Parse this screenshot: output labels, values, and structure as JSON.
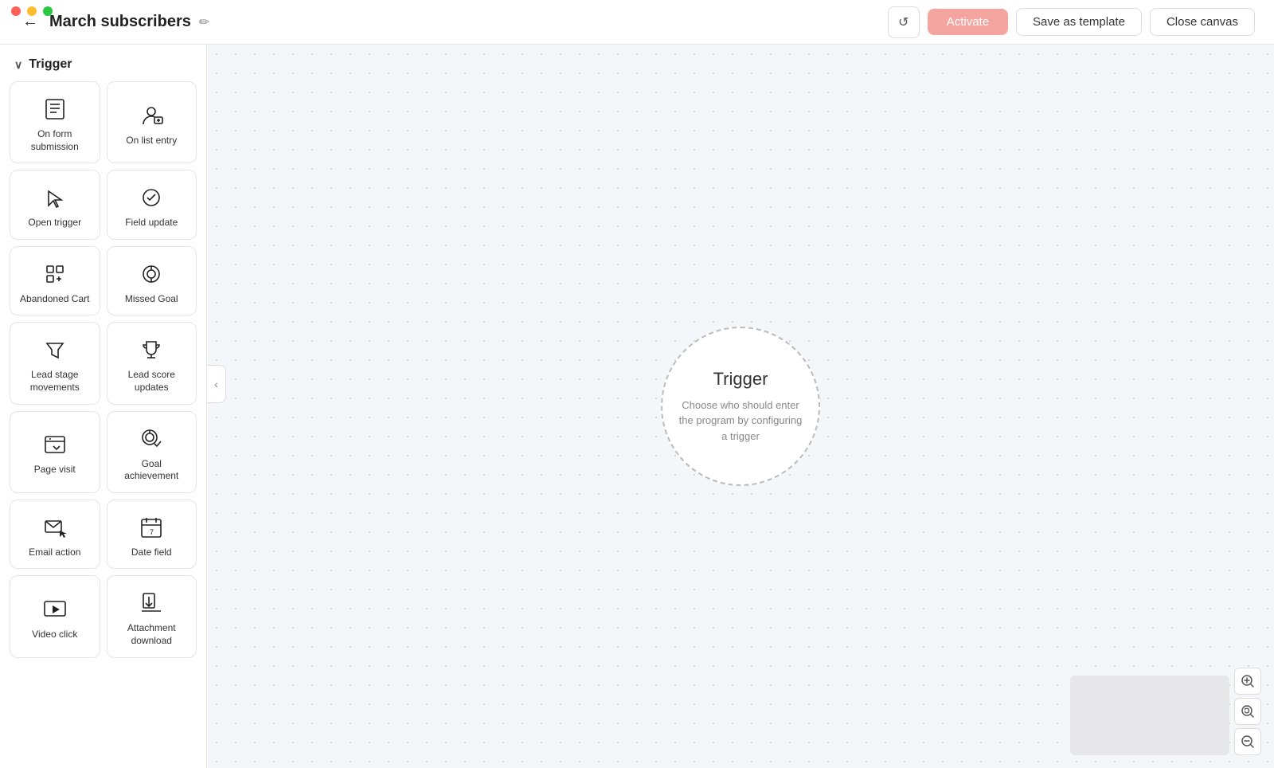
{
  "app": {
    "traffic_lights": [
      "red",
      "yellow",
      "green"
    ]
  },
  "header": {
    "back_icon": "←",
    "title": "March subscribers",
    "edit_icon": "✏",
    "refresh_icon": "↺",
    "activate_label": "Activate",
    "save_template_label": "Save as template",
    "close_canvas_label": "Close canvas"
  },
  "sidebar": {
    "section_label": "Trigger",
    "chevron": "∨",
    "cards": [
      {
        "id": "on-form-submission",
        "label": "On form\nsubmission",
        "icon": "form"
      },
      {
        "id": "on-list-entry",
        "label": "On list entry",
        "icon": "person"
      },
      {
        "id": "open-trigger",
        "label": "Open trigger",
        "icon": "cursor"
      },
      {
        "id": "field-update",
        "label": "Field update",
        "icon": "checkmark-circle"
      },
      {
        "id": "abandoned-cart",
        "label": "Abandoned Cart",
        "icon": "cart"
      },
      {
        "id": "missed-goal",
        "label": "Missed Goal",
        "icon": "target"
      },
      {
        "id": "lead-stage-movements",
        "label": "Lead stage\nmovements",
        "icon": "funnel"
      },
      {
        "id": "lead-score-updates",
        "label": "Lead score\nupdates",
        "icon": "trophy"
      },
      {
        "id": "page-visit",
        "label": "Page visit",
        "icon": "browser"
      },
      {
        "id": "goal-achievement",
        "label": "Goal\nachievement",
        "icon": "target-check"
      },
      {
        "id": "email-action",
        "label": "Email action",
        "icon": "email-cursor"
      },
      {
        "id": "date-field",
        "label": "Date field",
        "icon": "calendar"
      },
      {
        "id": "video-click",
        "label": "Video click",
        "icon": "play"
      },
      {
        "id": "attachment-download",
        "label": "Attachment\ndownload",
        "icon": "download"
      }
    ]
  },
  "canvas": {
    "trigger_title": "Trigger",
    "trigger_desc": "Choose who should enter the program by configuring a trigger"
  },
  "zoom": {
    "in": "+",
    "reset": "⟳",
    "out": "−"
  }
}
